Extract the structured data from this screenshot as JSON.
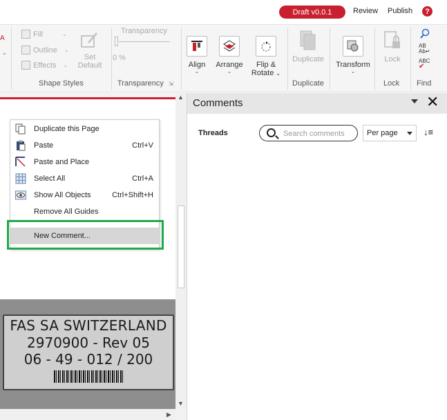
{
  "topbar": {
    "version_badge": "Draft v0.0.1",
    "review": "Review",
    "publish": "Publish",
    "help_icon": "?"
  },
  "ribbon": {
    "shape_styles": {
      "fill": "Fill",
      "outline": "Outline",
      "effects": "Effects",
      "set_default_line1": "Set",
      "set_default_line2": "Default",
      "group_label": "Shape Styles"
    },
    "transparency": {
      "label": "Transparency",
      "value": "0 %",
      "group_label": "Transparency"
    },
    "align": "Align",
    "arrange": "Arrange",
    "flip_rotate_line1": "Flip &",
    "flip_rotate_line2": "Rotate",
    "duplicate": "Duplicate",
    "duplicate_group": "Duplicate",
    "transform": "Transform",
    "lock": "Lock",
    "lock_group": "Lock",
    "find_group": "Find"
  },
  "context_menu": {
    "items": [
      {
        "label": "Duplicate this Page",
        "shortcut": "",
        "icon": "duplicate-page-icon"
      },
      {
        "label": "Paste",
        "shortcut": "Ctrl+V",
        "icon": "paste-icon"
      },
      {
        "label": "Paste and Place",
        "shortcut": "",
        "icon": "paste-place-icon"
      },
      {
        "label": "Select All",
        "shortcut": "Ctrl+A",
        "icon": "select-all-icon"
      },
      {
        "label": "Show All Objects",
        "shortcut": "Ctrl+Shift+H",
        "icon": "eye-icon"
      },
      {
        "label": "Remove All Guides",
        "shortcut": "",
        "icon": ""
      },
      {
        "label": "New Comment...",
        "shortcut": "",
        "icon": ""
      }
    ]
  },
  "label": {
    "line1": "FAS SA SWITZERLAND",
    "line2": "2970900 - Rev 05",
    "line3": "06 - 49   -   012 / 200"
  },
  "comments_panel": {
    "title": "Comments",
    "threads_label": "Threads",
    "search_placeholder": "Search comments",
    "per_page": "Per page"
  },
  "colors": {
    "accent": "#c8202f",
    "highlight_frame": "#1fa94a"
  }
}
